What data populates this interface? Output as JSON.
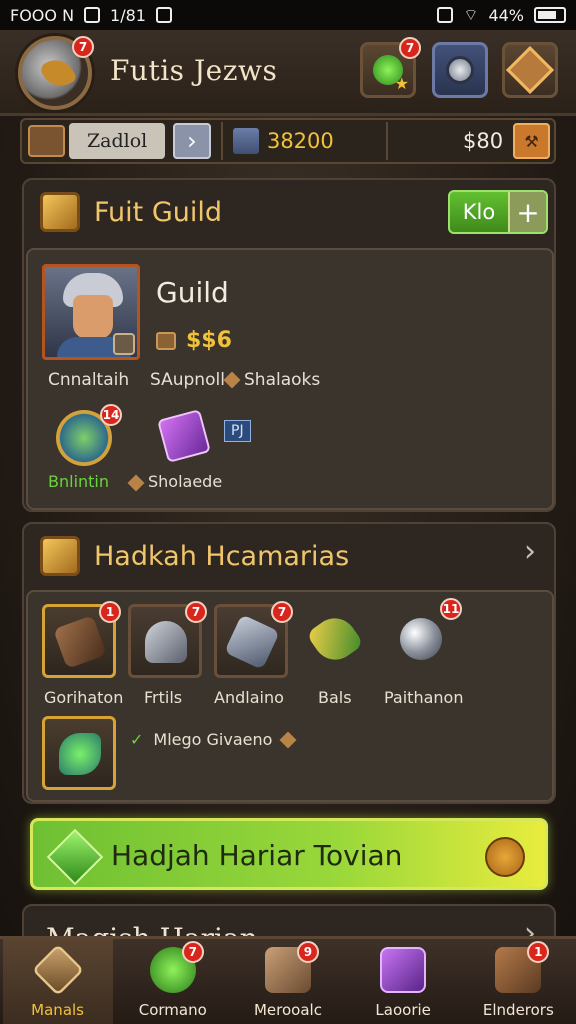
{
  "status_bar": {
    "left": [
      "FOOO N",
      "1/81"
    ],
    "battery_text": "44%"
  },
  "header": {
    "title": "Futis Jezws",
    "avatar_badge": "7",
    "btn_badge": "7"
  },
  "resources": {
    "name": "Zadlol",
    "value_gold": "38200",
    "value_plain": "$80"
  },
  "guild_panel": {
    "title": "Fuit Guild",
    "klo_label": "Klo",
    "card": {
      "name": "Guild",
      "stat": "$$6",
      "label_1": "Cnnaltaih",
      "label_2": "SAupnoll",
      "label_3": "Shalaoks",
      "reward_badge": "14",
      "reward_label": "Bnlintin",
      "reward_label_2": "Sholaede",
      "count_tag": "PJ"
    }
  },
  "heroes_panel": {
    "title": "Hadkah Hcamarias",
    "items": [
      {
        "label": "Gorihaton",
        "badge": "1"
      },
      {
        "label": "Frtils",
        "badge": "7"
      },
      {
        "label": "Andlaino",
        "badge": "7"
      },
      {
        "label": "Bals",
        "badge": ""
      },
      {
        "label": "Paithanon",
        "badge": "11"
      }
    ],
    "footer_label": "Mlego Givaeno"
  },
  "daily_button": {
    "label": "Hadjah Hariar Tovian"
  },
  "next_panel": {
    "title": "Magish Harian"
  },
  "bottom_nav": [
    {
      "label": "Manals",
      "badge": ""
    },
    {
      "label": "Cormano",
      "badge": "7"
    },
    {
      "label": "Merooalc",
      "badge": "9"
    },
    {
      "label": "Laoorie",
      "badge": ""
    },
    {
      "label": "Elnderors",
      "badge": "1"
    }
  ],
  "colors": {
    "accent_gold": "#f0c66a",
    "green": "#62c030",
    "badge_red": "#d8261d"
  }
}
